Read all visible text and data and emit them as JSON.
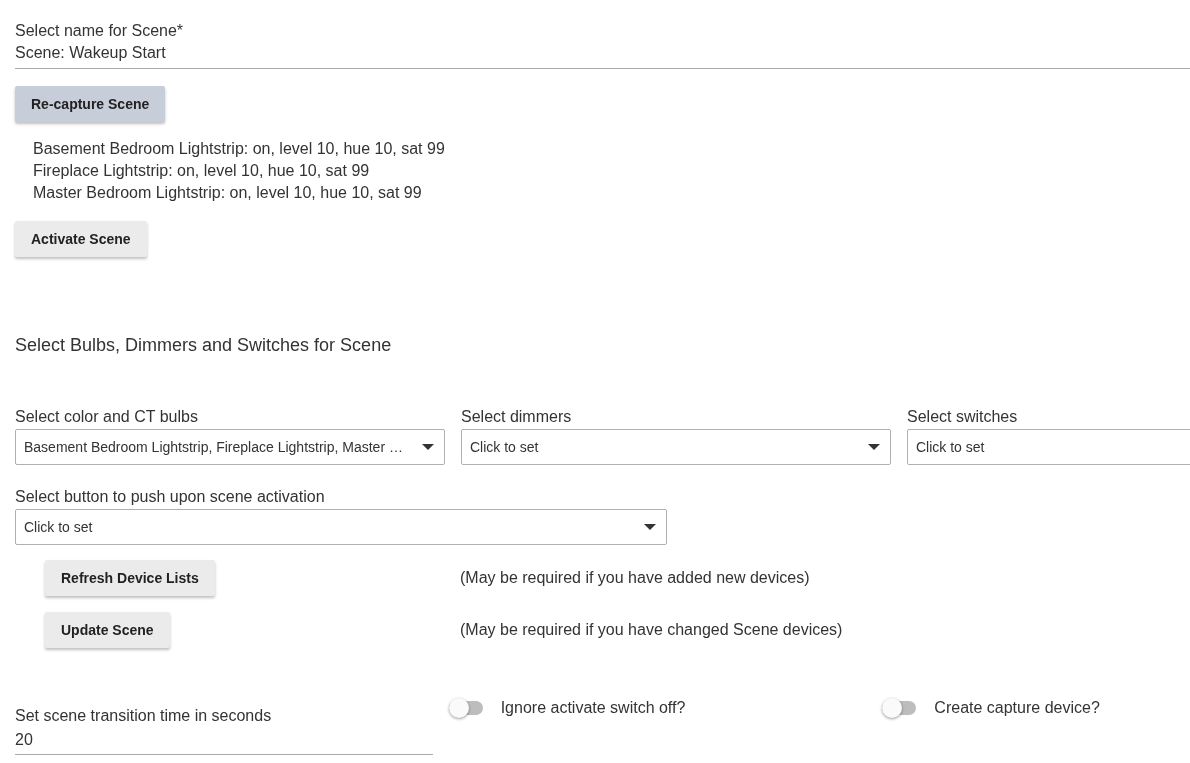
{
  "scene_name": {
    "label": "Select name for Scene*",
    "value": "Scene: Wakeup Start"
  },
  "recapture_button": "Re-capture Scene",
  "captured_devices": [
    "Basement Bedroom Lightstrip: on, level 10, hue 10, sat 99",
    "Fireplace Lightstrip: on, level 10, hue 10, sat 99",
    "Master Bedroom Lightstrip: on, level 10, hue 10, sat 99"
  ],
  "activate_button": "Activate Scene",
  "section_heading": "Select Bulbs, Dimmers and Switches for Scene",
  "device_selects": [
    {
      "label": "Select color and CT bulbs",
      "value": "Basement Bedroom Lightstrip, Fireplace Lightstrip, Master …"
    },
    {
      "label": "Select dimmers",
      "value": "Click to set"
    },
    {
      "label": "Select switches",
      "value": "Click to set"
    }
  ],
  "button_select": {
    "label": "Select button to push upon scene activation",
    "value": "Click to set"
  },
  "actions": [
    {
      "button": "Refresh Device Lists",
      "note": "(May be required if you have added new devices)"
    },
    {
      "button": "Update Scene",
      "note": "(May be required if you have changed Scene devices)"
    }
  ],
  "transition": {
    "label": "Set scene transition time in seconds",
    "value": "20"
  },
  "toggles": [
    {
      "label": "Ignore activate switch off?",
      "on": false
    },
    {
      "label": "Create capture device?",
      "on": false
    }
  ]
}
